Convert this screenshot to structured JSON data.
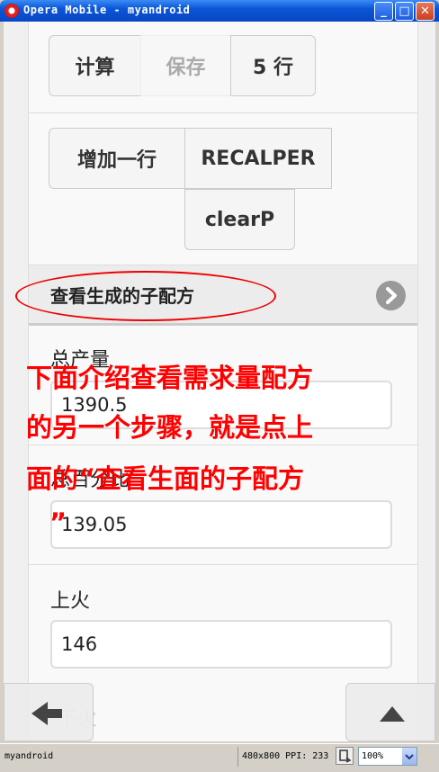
{
  "window": {
    "title": "Opera Mobile - myandroid",
    "minimize": "_",
    "maximize": "□",
    "close": "✕"
  },
  "toolbar1": {
    "calc": "计算",
    "save": "保存",
    "rows": "5 行"
  },
  "toolbar2": {
    "add_row": "增加一行",
    "recalper": "RECALPER",
    "clearp": "clearP"
  },
  "collapsible": {
    "label": "查看生成的子配方"
  },
  "fields": [
    {
      "label": "总产量",
      "value": "1390.5"
    },
    {
      "label": "总百分比",
      "value": "139.05"
    },
    {
      "label": "上火",
      "value": "146"
    }
  ],
  "annotation": {
    "line1": "下面介绍查看需求量配方",
    "line2": "的另一个步骤，就是点上",
    "line3": "面的“查看生面的子配方",
    "line4": "”"
  },
  "hidden_label": "下火",
  "status": {
    "name": "myandroid",
    "info": "480x800 PPI: 233",
    "zoom": "100%"
  },
  "colors": {
    "annotation": "#ff0000",
    "titlebar": "#0a56d8"
  },
  "icons": {
    "back": "arrow-left-icon",
    "up": "triangle-up-icon",
    "collapsible": "chevron-right-icon"
  }
}
